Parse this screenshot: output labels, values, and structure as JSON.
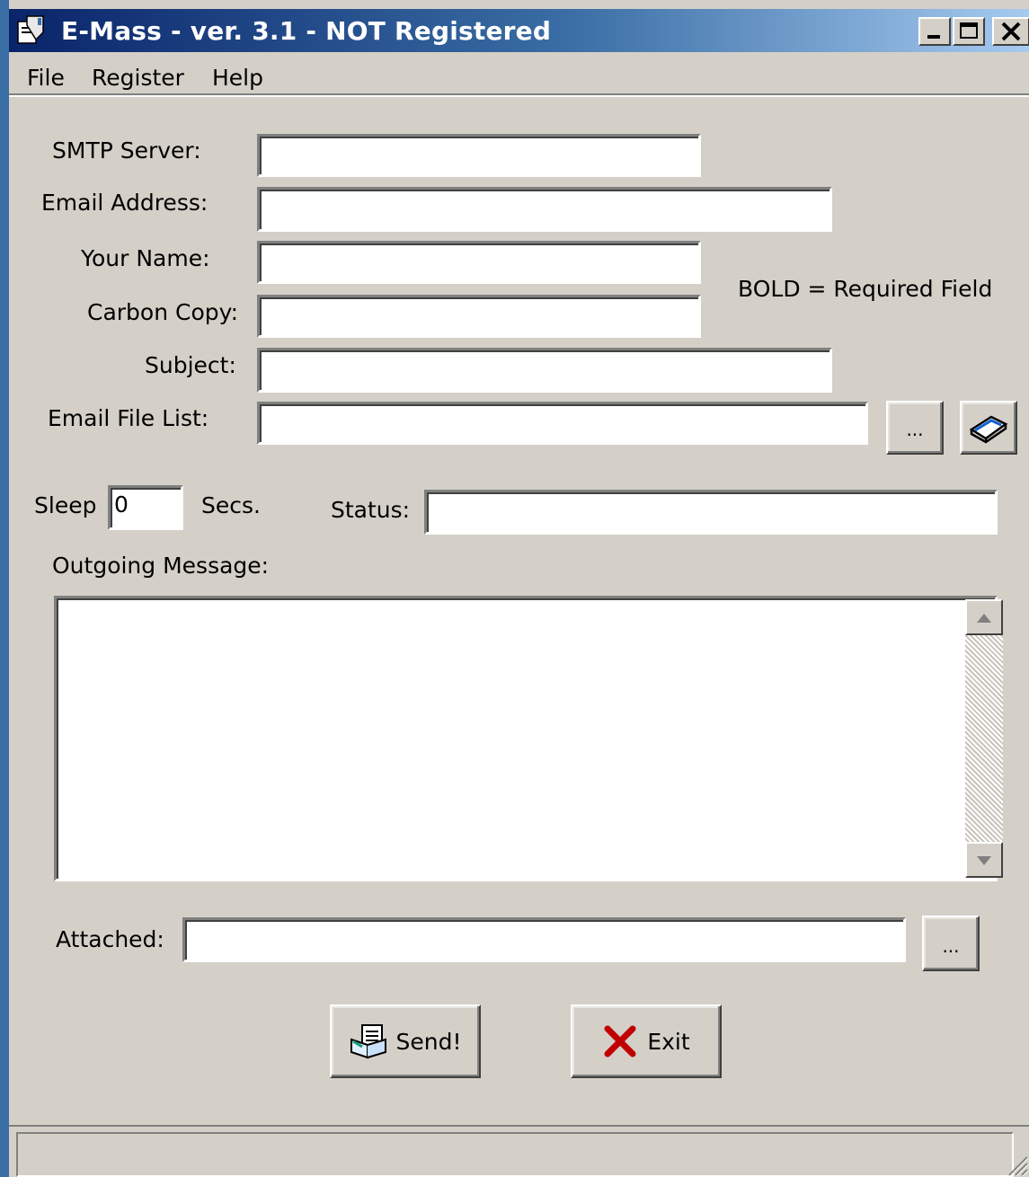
{
  "window": {
    "title": "E-Mass - ver. 3.1 - NOT Registered"
  },
  "menu": [
    "File",
    "Register",
    "Help"
  ],
  "form": {
    "smtp_label": "SMTP Server:",
    "email_label": "Email Address:",
    "name_label": "Your Name:",
    "cc_label": "Carbon Copy:",
    "subject_label": "Subject:",
    "filelist_label": "Email File List:",
    "required_note": "BOLD = Required Field",
    "browse_label": "...",
    "sleep_label": "Sleep",
    "sleep_value": "0",
    "secs_label": "Secs.",
    "status_label": "Status:",
    "message_label": "Outgoing Message:",
    "attached_label": "Attached:",
    "attach_browse_label": "..."
  },
  "buttons": {
    "send": "Send!",
    "exit": "Exit"
  },
  "colors": {
    "face": "#d4d0c8",
    "title_start": "#0a246a",
    "title_end": "#a6caf0",
    "exit_x": "#c00000"
  }
}
